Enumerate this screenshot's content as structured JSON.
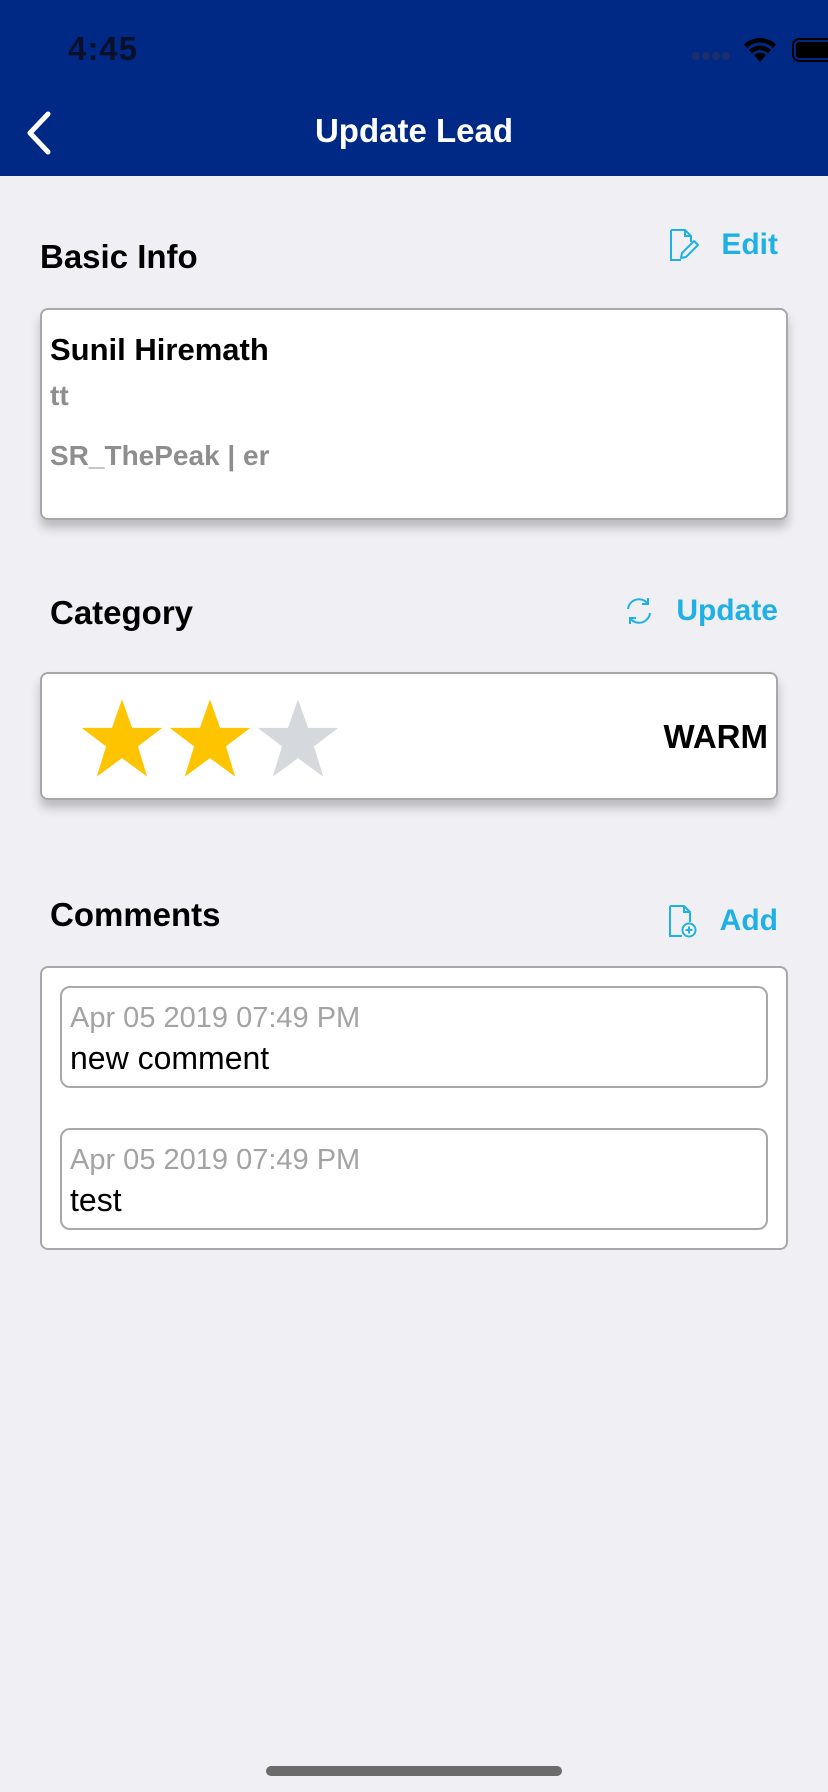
{
  "status_bar": {
    "time": "4:45"
  },
  "nav": {
    "title": "Update Lead"
  },
  "basic_info": {
    "title": "Basic Info",
    "action_label": "Edit",
    "name": "Sunil Hiremath",
    "subtitle": "tt",
    "meta": "SR_ThePeak | er"
  },
  "category": {
    "title": "Category",
    "action_label": "Update",
    "rating": 2,
    "rating_max": 3,
    "label": "WARM"
  },
  "comments": {
    "title": "Comments",
    "action_label": "Add",
    "items": [
      {
        "date": "Apr 05 2019 07:49 PM",
        "text": "new comment"
      },
      {
        "date": "Apr 05 2019 07:49 PM",
        "text": "test"
      }
    ]
  },
  "colors": {
    "header": "#002985",
    "accent": "#1fb1e6",
    "star_filled": "#ffc400",
    "star_empty": "#d5d8dc"
  }
}
